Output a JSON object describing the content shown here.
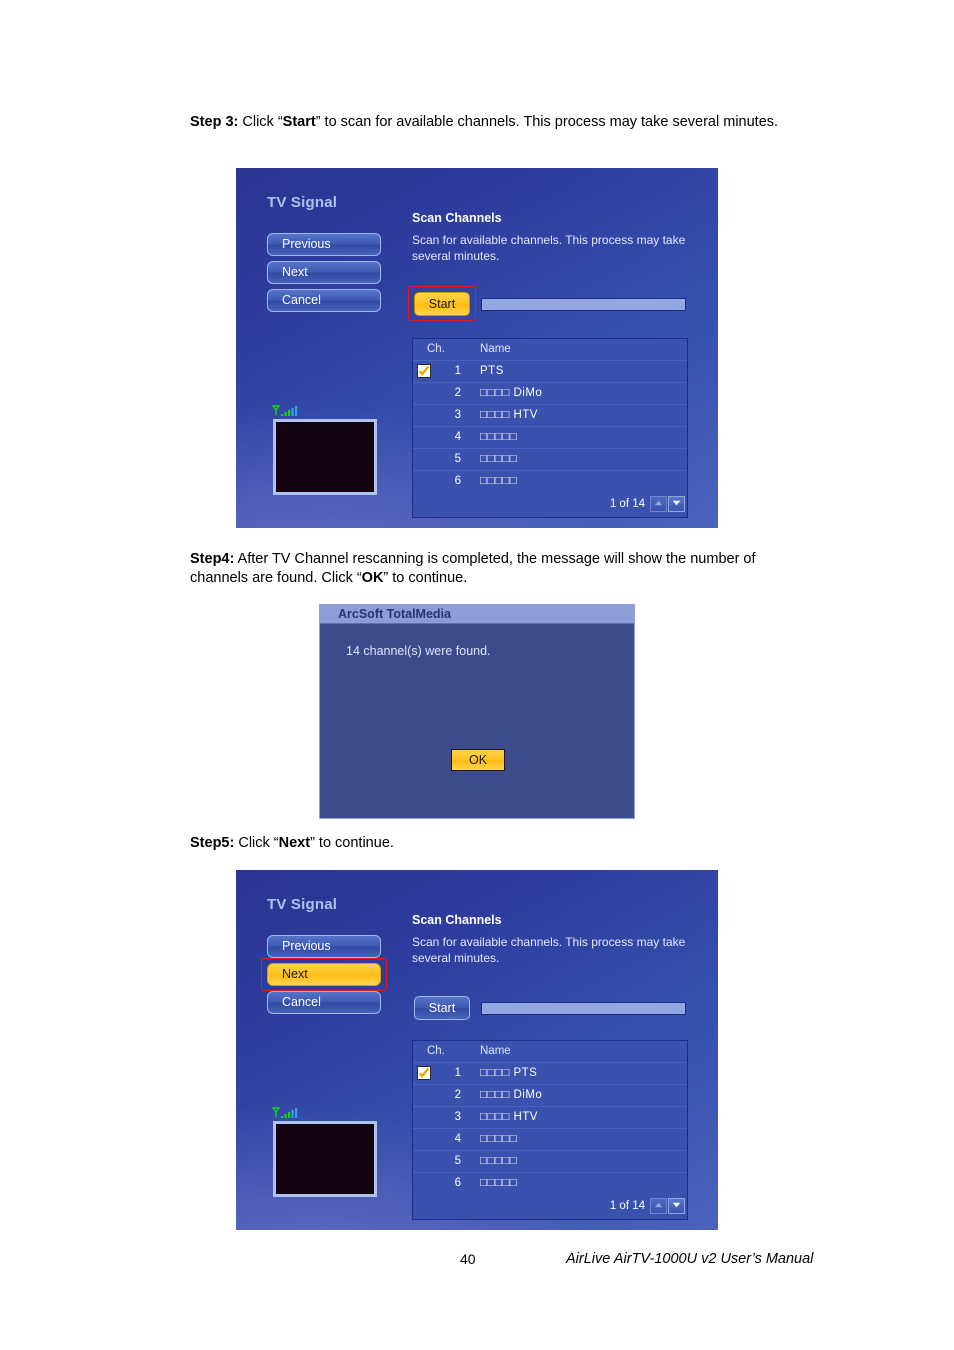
{
  "page": {
    "number": "40",
    "manual_title": "AirLive AirTV-1000U v2 User’s Manual"
  },
  "steps": [
    {
      "label": "Step 3:",
      "text": " Click “Start” to scan for available channels. This process may take several minutes.",
      "html": "<b>Step 3:</b> Click “<b>Start</b>” to scan for available channels. This process may take several minutes."
    },
    {
      "label": "Step4:",
      "text": " After TV Channel rescanning is completed, the message will show the number of channels are found. Click “OK” to continue.",
      "html": "<b>Step4:</b> After TV Channel rescanning is completed, the message will show the number of channels are found. Click “<b>OK</b>” to continue."
    },
    {
      "label": "Step5:",
      "text": " Click “Next” to continue.",
      "html": "<b>Step5:</b> Click “<b>Next</b>” to continue."
    }
  ],
  "dialog1": {
    "title": "TV Signal",
    "nav_buttons": [
      {
        "label": "Previous",
        "highlight": false
      },
      {
        "label": "Next",
        "highlight": false
      },
      {
        "label": "Cancel",
        "highlight": false
      }
    ],
    "section_heading": "Scan Channels",
    "section_description": "Scan for available channels. This process may take several minutes.",
    "start_button": {
      "label": "Start",
      "style": "yellow",
      "annotated": true
    },
    "progress": {
      "value": 0
    },
    "signal_icon": "signal-strength-icon",
    "preview": "tv-preview-black",
    "table": {
      "headers": [
        "Ch.",
        "Name"
      ],
      "rows": [
        {
          "ch": "1",
          "name": "PTS",
          "checked": true
        },
        {
          "ch": "2",
          "name": "□□□□ DiMo",
          "checked": false
        },
        {
          "ch": "3",
          "name": "□□□□ HTV",
          "checked": false
        },
        {
          "ch": "4",
          "name": "□□□□□",
          "checked": false
        },
        {
          "ch": "5",
          "name": "□□□□□",
          "checked": false
        },
        {
          "ch": "6",
          "name": "□□□□□",
          "checked": false
        }
      ],
      "pagination": "1 of 14"
    }
  },
  "message_dialog": {
    "title": "ArcSoft TotalMedia",
    "message": "14 channel(s) were found.",
    "ok_label": "OK"
  },
  "dialog2": {
    "title": "TV Signal",
    "nav_buttons": [
      {
        "label": "Previous",
        "highlight": false
      },
      {
        "label": "Next",
        "highlight": true
      },
      {
        "label": "Cancel",
        "highlight": false
      }
    ],
    "section_heading": "Scan Channels",
    "section_description": "Scan for available channels. This process may take several minutes.",
    "start_button": {
      "label": "Start",
      "style": "blue",
      "annotated": false
    },
    "progress": {
      "value": 0
    },
    "signal_icon": "signal-strength-icon",
    "preview": "tv-preview-black",
    "table": {
      "headers": [
        "Ch.",
        "Name"
      ],
      "rows": [
        {
          "ch": "1",
          "name": "□□□□ PTS",
          "checked": true
        },
        {
          "ch": "2",
          "name": "□□□□ DiMo",
          "checked": false
        },
        {
          "ch": "3",
          "name": "□□□□ HTV",
          "checked": false
        },
        {
          "ch": "4",
          "name": "□□□□□",
          "checked": false
        },
        {
          "ch": "5",
          "name": "□□□□□",
          "checked": false
        },
        {
          "ch": "6",
          "name": "□□□□□",
          "checked": false
        }
      ],
      "pagination": "1 of 14"
    }
  },
  "colors": {
    "accent_yellow": "#ffc21f",
    "dialog_blue": "#3550ad",
    "annotation_red": "#e21b1b",
    "signal_green": "#19d21c"
  }
}
